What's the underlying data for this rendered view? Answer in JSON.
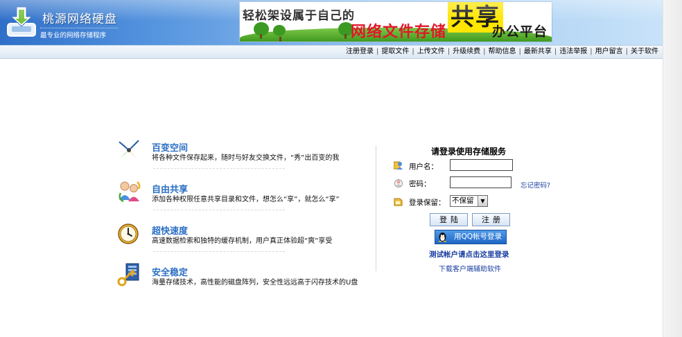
{
  "header": {
    "site_title": "桃源网络硬盘",
    "tagline": "最专业的网络存储程序",
    "banner": {
      "line_left": "轻松架设属于自己的",
      "line_main": "网络文件存储",
      "line_big": "共享",
      "line_right": "办公平台"
    }
  },
  "nav": {
    "items": [
      "注册登录",
      "提取文件",
      "上传文件",
      "升级续费",
      "帮助信息",
      "最新共享",
      "违法举报",
      "用户留言",
      "关于软件"
    ],
    "separator": "|"
  },
  "features": [
    {
      "title": "百变空间",
      "desc": "将各种文件保存起来，随时与好友交换文件，“秀”出百变的我",
      "icon": "pinwheel-icon"
    },
    {
      "title": "自由共享",
      "desc": "添加各种权限任意共享目录和文件，想怎么“享”，就怎么“享”",
      "icon": "people-share-icon"
    },
    {
      "title": "超快速度",
      "desc": "高速数据检索和独特的缓存机制，用户真正体验超“爽”享受",
      "icon": "clock-icon"
    },
    {
      "title": "安全稳定",
      "desc": "海量存储技术，高性能的磁盘阵列，安全性远远高于闪存技术的U盘",
      "icon": "key-lock-icon"
    }
  ],
  "login": {
    "title": "请登录使用存储服务",
    "username_label": "用户名：",
    "username_value": "",
    "password_label": "密码：",
    "password_value": "",
    "forgot_link": "忘记密码?",
    "remember_label": "登录保留：",
    "remember_value": "不保留",
    "login_button": "登陆",
    "register_button": "注册",
    "qq_button": "用QQ帐号登录",
    "test_link": "测试帐户请点击这里登录",
    "download_link": "下载客户端辅助软件"
  },
  "colors": {
    "accent_blue": "#2b6fc4",
    "link_blue": "#1a3fa0",
    "banner_red": "#e0182a",
    "banner_yellow": "#ffe600"
  }
}
